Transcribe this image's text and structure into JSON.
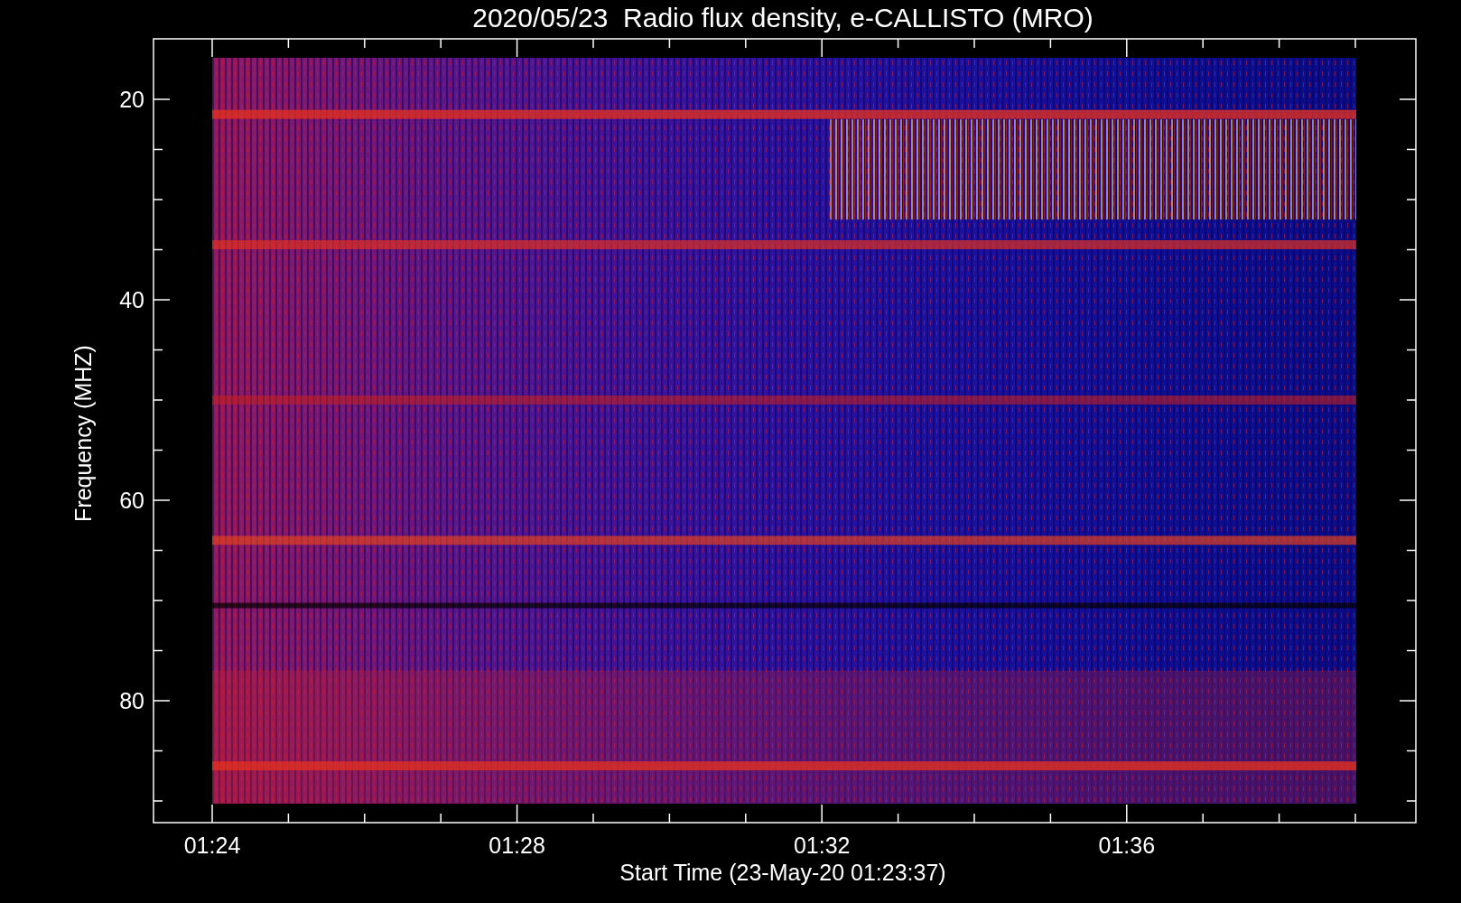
{
  "title": "2020/05/23  Radio flux density, e-CALLISTO (MRO)",
  "y_axis": {
    "label": "Frequency (MHZ)",
    "ticks": [
      "20",
      "40",
      "60",
      "80"
    ]
  },
  "x_axis": {
    "label": "Start Time (23-May-20 01:23:37)",
    "ticks": [
      "01:24",
      "01:28",
      "01:32",
      "01:36"
    ]
  }
}
